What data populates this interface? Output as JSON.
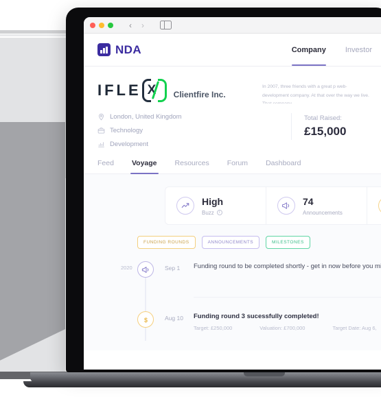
{
  "browser": {
    "traffic_lights": [
      "close",
      "minimize",
      "maximize"
    ],
    "back_label": "‹",
    "forward_label": "›"
  },
  "header": {
    "brand_name": "NDA",
    "brand_color": "#3b2ca0",
    "nav": [
      {
        "label": "Company",
        "active": true
      },
      {
        "label": "Investor",
        "active": false
      }
    ]
  },
  "company": {
    "logo_text": "IFLE",
    "logo_mark_letter": "X",
    "name": "Clientfire Inc.",
    "description": "In 2007, three friends with a great p web-development company. At that over the way we live. That company",
    "meta": [
      {
        "icon": "location-pin-icon",
        "label": "London, United Kingdom"
      },
      {
        "icon": "briefcase-icon",
        "label": "Technology"
      },
      {
        "icon": "chart-icon",
        "label": "Development"
      }
    ],
    "raised_label": "Total Raised:",
    "raised_value": "£15,000"
  },
  "tabs": [
    {
      "label": "Feed",
      "active": false
    },
    {
      "label": "Voyage",
      "active": true
    },
    {
      "label": "Resources",
      "active": false
    },
    {
      "label": "Forum",
      "active": false
    },
    {
      "label": "Dashboard",
      "active": false
    }
  ],
  "stats": [
    {
      "icon": "trend-up-icon",
      "value": "High",
      "label": "Buzz",
      "has_info": true
    },
    {
      "icon": "megaphone-icon",
      "value": "74",
      "label": "Announcements",
      "has_info": false
    }
  ],
  "filters": [
    {
      "label": "FUNDING ROUNDS",
      "color": "#c9a24b",
      "border": "#f3cf7e"
    },
    {
      "label": "ANNOUNCEMENTS",
      "color": "#8f86c9",
      "border": "#c5bdee"
    },
    {
      "label": "MILESTONES",
      "color": "#3bbd89",
      "border": "#5fd5a4"
    }
  ],
  "timeline": [
    {
      "year": "2020",
      "icon": "megaphone-icon",
      "date": "Sep 1",
      "title": "Funding round to be completed shortly - get in now before you mi",
      "bold": false,
      "details": []
    },
    {
      "year": "",
      "icon": "dollar-icon",
      "date": "Aug 10",
      "title": "Funding round 3 sucessfully completed!",
      "bold": true,
      "details": [
        "Target: £250,000",
        "Valuation: £700,000",
        "Target Date: Aug 6,"
      ]
    }
  ]
}
